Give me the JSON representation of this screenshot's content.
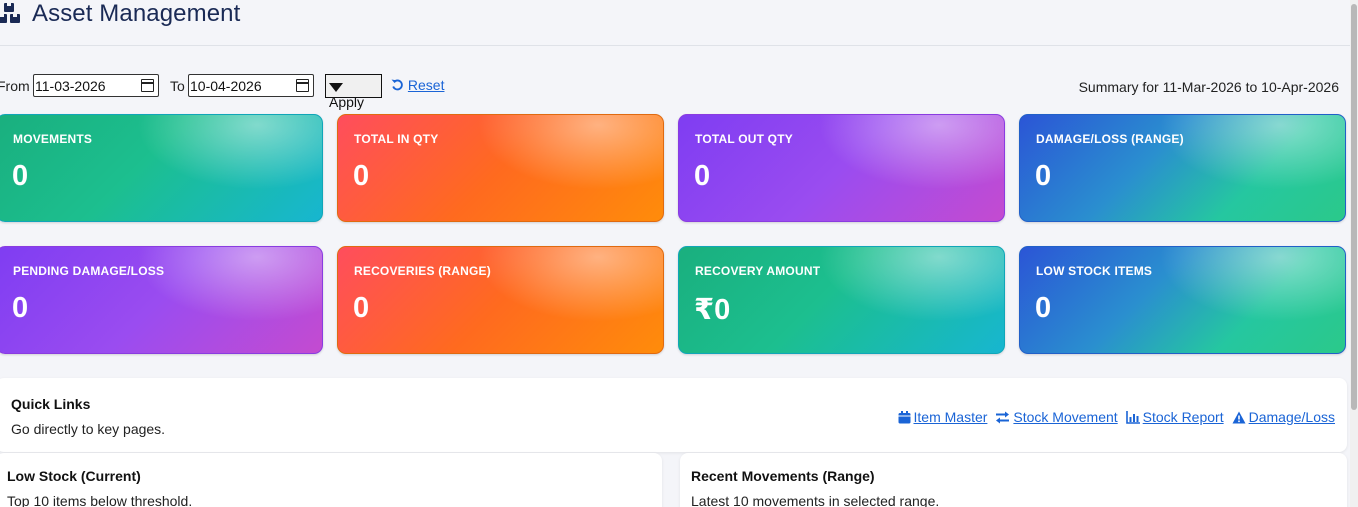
{
  "header": {
    "title": "Asset Management"
  },
  "filters": {
    "from_label": "From",
    "from_value": "11-03-2026",
    "to_label": "To",
    "to_value": "10-04-2026",
    "apply_label": "Apply",
    "reset_label": "Reset",
    "summary": "Summary for 11-Mar-2026 to 10-Apr-2026"
  },
  "cards": [
    {
      "label": "MOVEMENTS",
      "value": "0"
    },
    {
      "label": "TOTAL IN QTY",
      "value": "0"
    },
    {
      "label": "TOTAL OUT QTY",
      "value": "0"
    },
    {
      "label": "DAMAGE/LOSS (RANGE)",
      "value": "0"
    },
    {
      "label": "PENDING DAMAGE/LOSS",
      "value": "0"
    },
    {
      "label": "RECOVERIES (RANGE)",
      "value": "0"
    },
    {
      "label": "RECOVERY AMOUNT",
      "value": "₹0"
    },
    {
      "label": "LOW STOCK ITEMS",
      "value": "0"
    }
  ],
  "quick_links": {
    "title": "Quick Links",
    "subtitle": "Go directly to key pages.",
    "links": [
      {
        "label": "Item Master",
        "icon": "calendar-icon"
      },
      {
        "label": "Stock Movement",
        "icon": "exchange-icon"
      },
      {
        "label": "Stock Report",
        "icon": "bar-chart-icon"
      },
      {
        "label": "Damage/Loss",
        "icon": "warning-icon"
      }
    ]
  },
  "low_stock": {
    "title": "Low Stock (Current)",
    "subtitle": "Top 10 items below threshold."
  },
  "recent_movements": {
    "title": "Recent Movements (Range)",
    "subtitle": "Latest 10 movements in selected range."
  },
  "colors": {
    "link": "#1a64d6",
    "title": "#1a2a55"
  }
}
